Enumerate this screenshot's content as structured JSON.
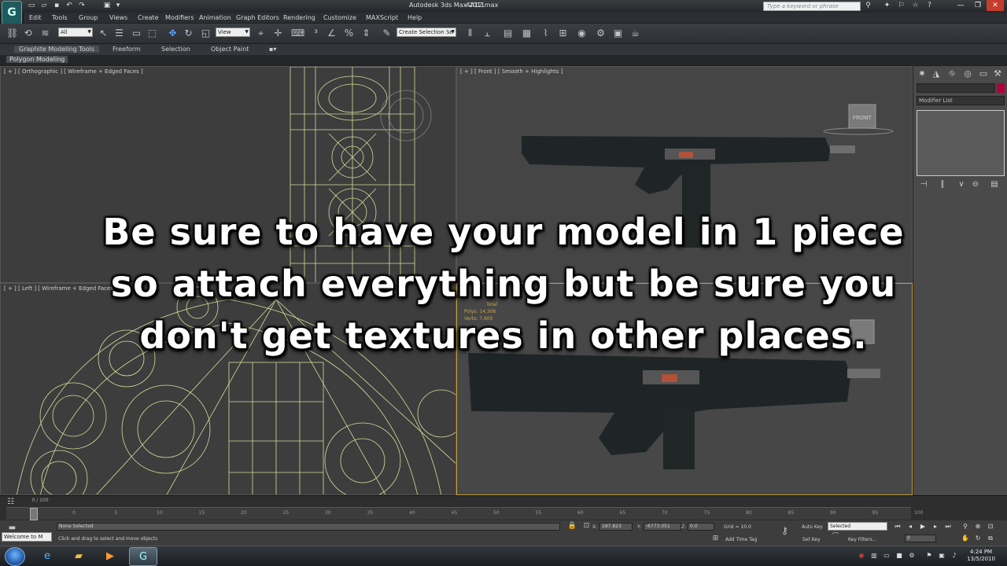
{
  "window": {
    "title": "Autodesk 3ds Max  2011",
    "file": "AA12.max",
    "help_search_placeholder": "Type a keyword or phrase"
  },
  "menu": [
    "Edit",
    "Tools",
    "Group",
    "Views",
    "Create",
    "Modifiers",
    "Animation",
    "Graph Editors",
    "Rendering",
    "Customize",
    "MAXScript",
    "Help"
  ],
  "toolbar": {
    "selection_filter": "All",
    "reference_coord": "View",
    "named_selection": "Create Selection Se"
  },
  "ribbon": {
    "tabs": [
      "Graphite Modeling Tools",
      "Freeform",
      "Selection",
      "Object Paint"
    ],
    "panel": "Polygon Modeling"
  },
  "viewports": {
    "top_left": "[ + ] [ Orthographic ] [ Wireframe + Edged Faces ]",
    "top_right": "[ + ] [ Front ] [ Smooth + Highlights ]",
    "bottom_left": "[ + ] [ Left ] [ Wireframe + Edged Faces ]",
    "front_cube": "FRONT",
    "stats": {
      "total_label": "Total",
      "polys_label": "Polys:",
      "polys_value": "14,306",
      "verts_label": "Verts:",
      "verts_value": "7,600"
    }
  },
  "command_panel": {
    "modifier_list": "Modifier List"
  },
  "overlay": {
    "line1": "Be sure to have your model in 1 piece",
    "line2": "so attach everything but be sure you",
    "line3": "don't get textures in other places."
  },
  "timeline": {
    "frame_counter": "0 / 100",
    "ticks": [
      "0",
      "5",
      "10",
      "15",
      "20",
      "25",
      "30",
      "35",
      "40",
      "45",
      "50",
      "55",
      "60",
      "65",
      "70",
      "75",
      "80",
      "85",
      "90",
      "95",
      "100"
    ]
  },
  "status": {
    "maxscript": "Welcome to M",
    "selection": "None Selected",
    "prompt": "Click and drag to select and move objects",
    "x_label": "X:",
    "x_value": "187.823",
    "y_label": "Y:",
    "y_value": "-6773.051",
    "z_label": "Z:",
    "z_value": "0.0",
    "grid": "Grid = 10.0",
    "add_time_tag": "Add Time Tag",
    "auto_key": "Auto Key",
    "set_key": "Set Key",
    "key_mode": "Selected",
    "key_filters": "Key Filters...",
    "current_frame": "0"
  },
  "taskbar": {
    "time": "4:24 PM",
    "date": "13/5/2010"
  },
  "colors": {
    "wireframe": "#d6dc9a",
    "accent_red": "#b0003a",
    "viewport_bg": "#3a3a3a"
  }
}
